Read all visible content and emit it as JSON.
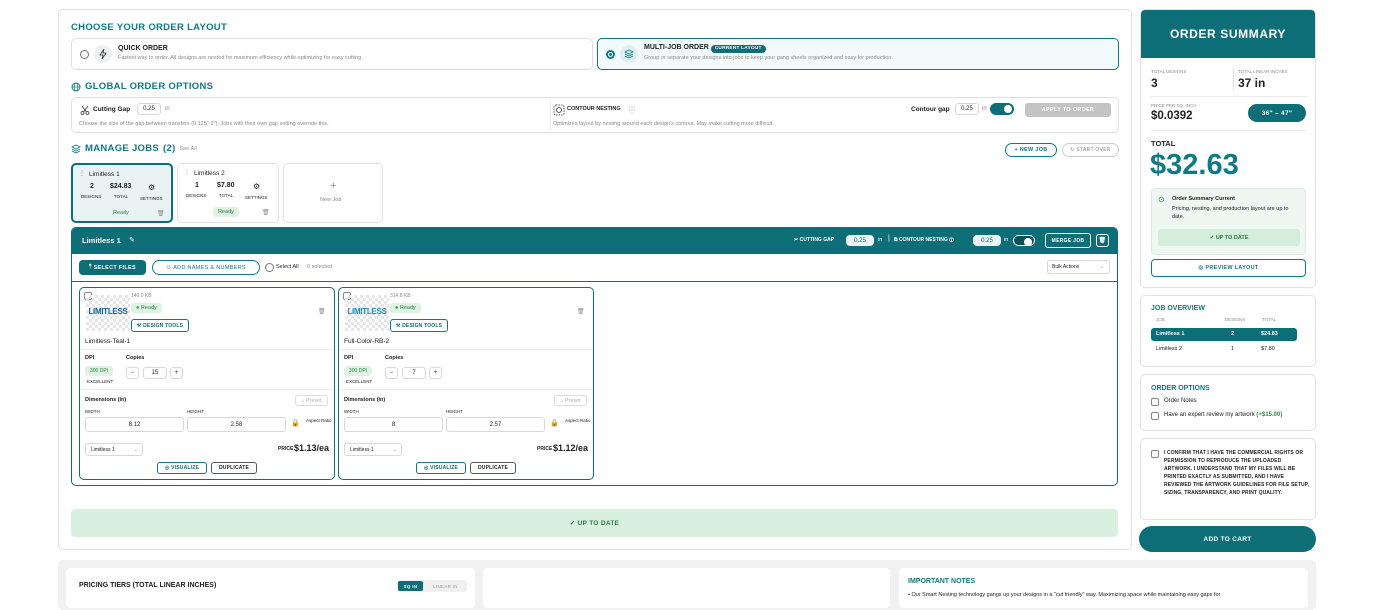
{
  "layout": {
    "title": "CHOOSE YOUR ORDER LAYOUT",
    "quick": {
      "name": "QUICK ORDER",
      "desc": "Fastest way to order. All designs are nested for maximum efficiency while optimizing for easy cutting."
    },
    "multi": {
      "name": "MULTI-JOB ORDER",
      "badge": "CURRENT LAYOUT",
      "desc": "Group or separate your designs into jobs to keep your gang sheets organized and easy for production."
    }
  },
  "global": {
    "title": "GLOBAL ORDER OPTIONS",
    "cutting_gap_label": "Cutting Gap",
    "cutting_gap_value": "0.25",
    "unit": "in",
    "cutting_gap_desc": "Choose the size of the gap between transfers (0.125\"-2\"). Jobs with their own gap setting override this.",
    "contour_label": "CONTOUR NESTING",
    "contour_desc": "Optimizes layout by nesting around each design's contour. May make cutting more difficult.",
    "contour_gap_label": "Contour gap",
    "contour_gap_value": "0.25",
    "apply_label": "APPLY TO ORDER"
  },
  "jobs": {
    "title": "MANAGE JOBS",
    "count": "(2)",
    "see_all": "See All",
    "new_job_btn": "+ NEW JOB",
    "start_over_btn": "START OVER",
    "cards": [
      {
        "name": "Limitless 1",
        "designs": "2",
        "designs_label": "DESIGNS",
        "total": "$24.83",
        "total_label": "TOTAL",
        "settings": "SETTINGS",
        "status": "Ready"
      },
      {
        "name": "Limitless 2",
        "designs": "1",
        "designs_label": "DESIGNS",
        "total": "$7.80",
        "total_label": "TOTAL",
        "settings": "SETTINGS",
        "status": "Ready"
      }
    ],
    "new_job": "New Job"
  },
  "editor": {
    "job_name": "Limitless 1",
    "cutting_gap_label": "CUTTING GAP",
    "cutting_gap_value": "0.25",
    "unit": "in",
    "contour_label": "CONTOUR NESTING",
    "contour_value": "0.25",
    "merge_btn": "MERGE JOB",
    "select_files": "SELECT FILES",
    "add_names": "ADD NAMES & NUMBERS",
    "select_all": "Select All",
    "selected": "0 selected",
    "bulk": "Bulk Actions",
    "designs": [
      {
        "size": "146.0 KB",
        "status": "Ready",
        "tools": "DESIGN TOOLS",
        "name": "Limitless-Teal-1",
        "logo": "LIMITLESS",
        "dpi_label": "DPI",
        "dpi": "300 DPI",
        "quality": "EXCELLENT",
        "copies_label": "Copies",
        "copies": "15",
        "dims_label": "Dimensions (in)",
        "preset": "Preset",
        "width_label": "WIDTH",
        "height_label": "HEIGHT",
        "width": "8.12",
        "height": "2.58",
        "aspect": "Aspect Ratio",
        "job": "Limitless 1",
        "price_label": "PRICE",
        "price": "$1.13/ea",
        "visualize": "VISUALIZE",
        "duplicate": "DUPLICATE"
      },
      {
        "size": "314.8 KB",
        "status": "Ready",
        "tools": "DESIGN TOOLS",
        "name": "Full-Color-RB-2",
        "logo": "LIMITLESS",
        "dpi_label": "DPI",
        "dpi": "300 DPI",
        "quality": "EXCELLENT",
        "copies_label": "Copies",
        "copies": "7",
        "dims_label": "Dimensions (in)",
        "preset": "Preset",
        "width_label": "WIDTH",
        "height_label": "HEIGHT",
        "width": "8",
        "height": "2.57",
        "aspect": "Aspect Ratio",
        "job": "Limitless 1",
        "price_label": "PRICE",
        "price": "$1.12/ea",
        "visualize": "VISUALIZE",
        "duplicate": "DUPLICATE"
      }
    ]
  },
  "up_to_date": "✓ UP TO DATE",
  "summary": {
    "title": "ORDER SUMMARY",
    "total_designs_label": "TOTAL DESIGNS",
    "total_designs": "3",
    "total_linear_label": "TOTAL LINEAR INCHES",
    "total_linear": "37 in",
    "price_label": "PRICE PER SQ. INCH",
    "price": "$0.0392",
    "range": "36\" – 47\"",
    "total_label": "TOTAL",
    "total": "$32.63",
    "current_title": "Order Summary Current",
    "current_desc": "Pricing, nesting, and production layout are up to date.",
    "uptodate": "✓ UP TO DATE",
    "preview": "PREVIEW LAYOUT"
  },
  "overview": {
    "title": "JOB OVERVIEW",
    "cols": [
      "JOB",
      "DESIGNS",
      "TOTAL"
    ],
    "rows": [
      [
        "Limitless 1",
        "2",
        "$24.83"
      ],
      [
        "Limitless 2",
        "1",
        "$7.80"
      ]
    ]
  },
  "order_options": {
    "title": "ORDER OPTIONS",
    "notes": "Order Notes",
    "expert": "Have an expert review my artwork",
    "expert_price": "(+$15.00)"
  },
  "confirm": "I CONFIRM THAT I HAVE THE COMMERCIAL RIGHTS OR PERMISSION TO REPRODUCE THE UPLOADED ARTWORK. I UNDERSTAND THAT MY FILES WILL BE PRINTED EXACTLY AS SUBMITTED, AND I HAVE REVIEWED THE ARTWORK GUIDELINES FOR FILE SETUP, SIZING, TRANSPARENCY, AND PRINT QUALITY.",
  "add_to_cart": "ADD TO CART",
  "bottom": {
    "tiers_title": "PRICING TIERS (TOTAL LINEAR INCHES)",
    "sq_in": "SQ IN",
    "linear_in": "LINEAR IN",
    "notes_title": "IMPORTANT NOTES",
    "notes_text": "• Our Smart Nesting technology gangs up your designs in a \"cut friendly\" way. Maximizing space while maintaining easy gaps for"
  }
}
